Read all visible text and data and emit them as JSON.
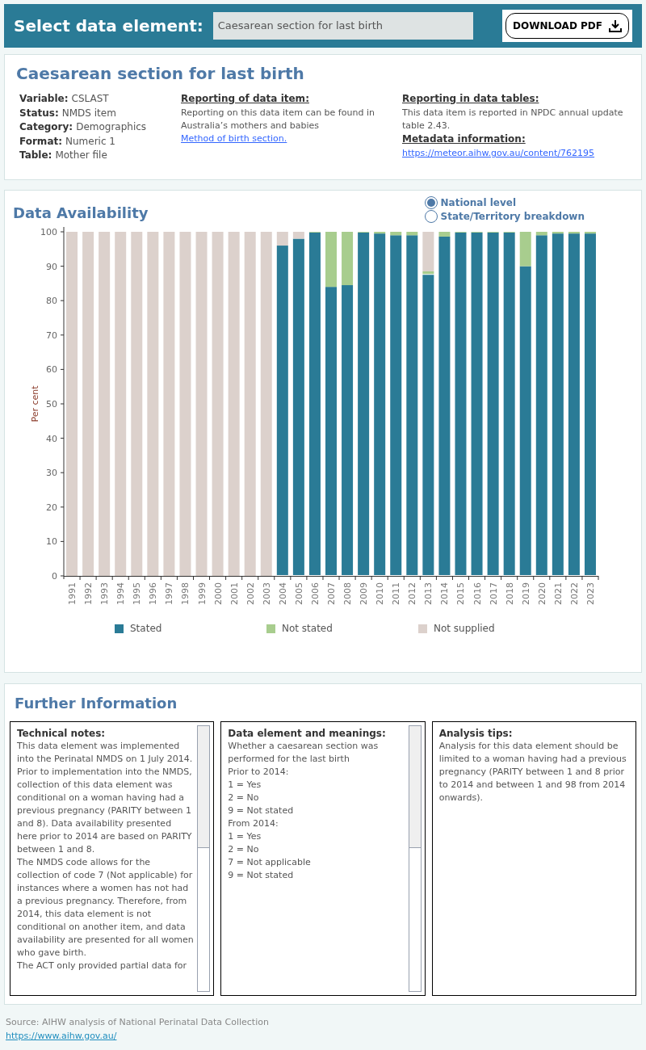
{
  "header": {
    "label": "Select data element:",
    "selector_value": "Caesarean section for last birth",
    "download_button": "DOWNLOAD PDF"
  },
  "summary": {
    "title": "Caesarean section for last birth",
    "fields": [
      {
        "label": "Variable:",
        "value": "CSLAST"
      },
      {
        "label": "Status:",
        "value": "NMDS item"
      },
      {
        "label": "Category:",
        "value": "Demographics"
      },
      {
        "label": "Format:",
        "value": "Numeric 1"
      },
      {
        "label": "Table:",
        "value": "Mother file"
      }
    ],
    "reporting_item": {
      "heading": "Reporting of data item:",
      "text": "Reporting on this data item can be found in Australia’s mothers and babies",
      "link": "Method of birth section."
    },
    "reporting_tables": {
      "heading": "Reporting in data tables:",
      "text": "This data item is reported in NPDC annual update table 2.43."
    },
    "metadata": {
      "heading": "Metadata information:",
      "link": "https://meteor.aihw.gov.au/content/762195"
    }
  },
  "availability": {
    "title": "Data Availability",
    "options": [
      {
        "label": "National level",
        "selected": true
      },
      {
        "label": "State/Territory breakdown",
        "selected": false
      }
    ],
    "chart_data": {
      "type": "bar",
      "ylabel": "Per cent",
      "stacked": true,
      "orientation": "vertical",
      "categories": [
        "1991",
        "1992",
        "1993",
        "1994",
        "1995",
        "1996",
        "1997",
        "1998",
        "1999",
        "2000",
        "2001",
        "2002",
        "2003",
        "2004",
        "2005",
        "2006",
        "2007",
        "2008",
        "2009",
        "2010",
        "2011",
        "2012",
        "2013",
        "2014",
        "2015",
        "2016",
        "2017",
        "2018",
        "2019",
        "2020",
        "2021",
        "2022",
        "2023"
      ],
      "series": [
        {
          "name": "Stated",
          "color": "#2a7b96",
          "values": [
            0,
            0,
            0,
            0,
            0,
            0,
            0,
            0,
            0,
            0,
            0,
            0,
            0,
            96,
            98,
            99.8,
            84,
            84.5,
            99.8,
            99.5,
            99,
            99,
            87.5,
            98.6,
            99.8,
            99.8,
            99.8,
            99.8,
            90,
            99,
            99.5,
            99.5,
            99.5
          ]
        },
        {
          "name": "Not stated",
          "color": "#a8cd8e",
          "values": [
            0,
            0,
            0,
            0,
            0,
            0,
            0,
            0,
            0,
            0,
            0,
            0,
            0,
            0,
            0,
            0.2,
            16,
            15.5,
            0.2,
            0.5,
            1,
            1,
            1,
            1.4,
            0.2,
            0.2,
            0.2,
            0.2,
            10,
            1,
            0.5,
            0.5,
            0.5
          ]
        },
        {
          "name": "Not supplied",
          "color": "#dcd1cc",
          "values": [
            100,
            100,
            100,
            100,
            100,
            100,
            100,
            100,
            100,
            100,
            100,
            100,
            100,
            4,
            2,
            0,
            0,
            0,
            0,
            0,
            0,
            0,
            11.5,
            0,
            0,
            0,
            0,
            0,
            0,
            0,
            0,
            0,
            0
          ]
        }
      ],
      "ylim": [
        0,
        100
      ],
      "yticks": [
        0,
        10,
        20,
        30,
        40,
        50,
        60,
        70,
        80,
        90,
        100
      ]
    }
  },
  "further_information": {
    "title": "Further Information",
    "boxes": [
      {
        "heading": "Technical notes:",
        "scrollable": true,
        "lines": [
          "This data element was implemented into the Perinatal NMDS on 1 July 2014.",
          "Prior to implementation into the NMDS, collection of this data element was conditional on a woman having had a previous pregnancy (PARITY between 1 and 8). Data availability presented here prior to 2014 are based on PARITY between 1 and 8.",
          "The NMDS code allows for the collection of code 7 (Not applicable) for instances where a women has not had a previous pregnancy. Therefore, from 2014, this data element is not conditional on another item, and data availability are presented for all women who gave birth.",
          "The ACT only provided partial data for"
        ]
      },
      {
        "heading": "Data element and meanings:",
        "scrollable": true,
        "lines": [
          "Whether a caesarean section was performed for the last birth",
          "Prior to 2014:",
          "1 = Yes",
          "2 = No",
          "9 = Not stated",
          "From 2014:",
          "1 = Yes",
          "2 = No",
          "7 = Not applicable",
          "9 = Not stated"
        ]
      },
      {
        "heading": "Analysis tips:",
        "scrollable": false,
        "lines": [
          "Analysis for this data element should be limited to a woman having had a previous pregnancy (PARITY between 1 and 8 prior to 2014 and between 1 and 98 from 2014 onwards)."
        ]
      }
    ]
  },
  "footer": {
    "source": "Source: AIHW analysis of National Perinatal Data Collection",
    "link": "https://www.aihw.gov.au/"
  }
}
